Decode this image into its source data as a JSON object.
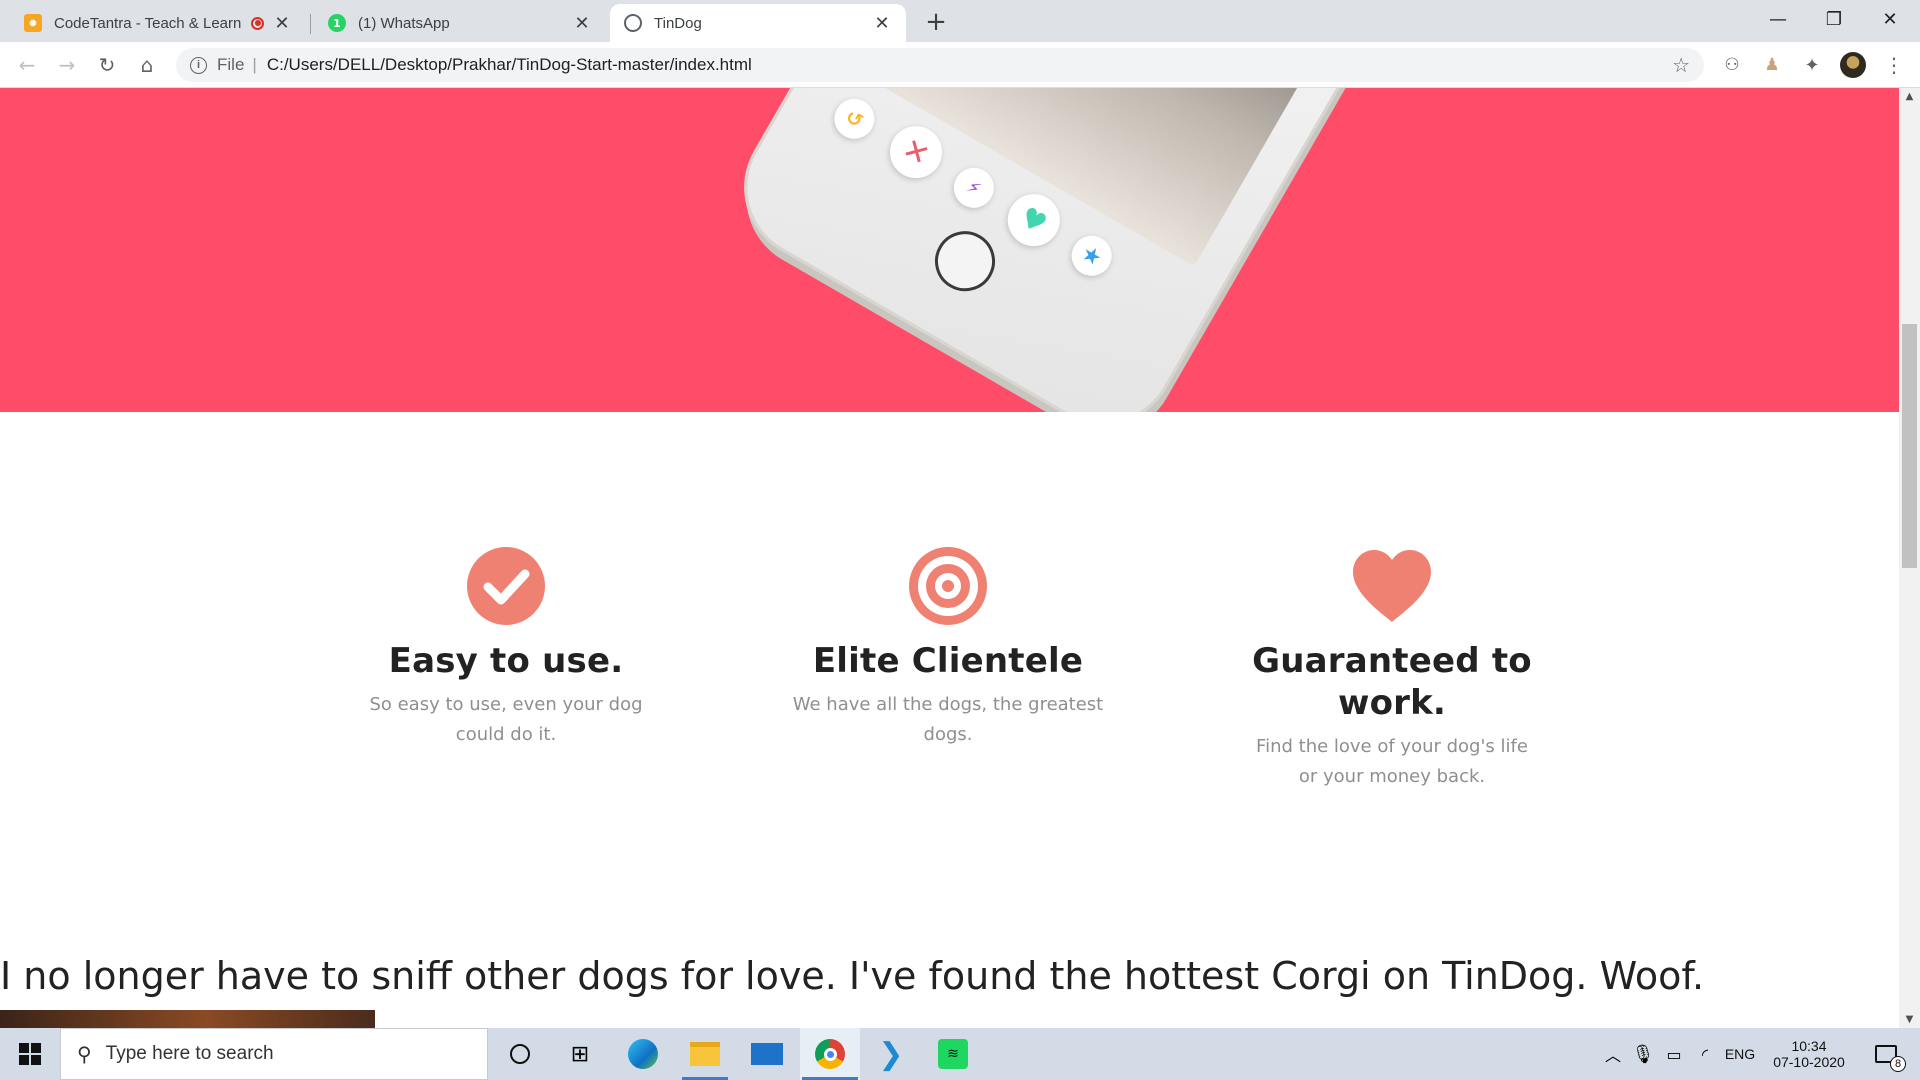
{
  "browser": {
    "tabs": [
      {
        "title": "CodeTantra - Teach & Learn",
        "favicon": "codetantra-icon"
      },
      {
        "title": "(1) WhatsApp",
        "favicon": "whatsapp-icon",
        "badge": "1"
      },
      {
        "title": "TinDog",
        "favicon": "globe-icon"
      }
    ],
    "address": {
      "scheme": "File",
      "path": "C:/Users/DELL/Desktop/Prakhar/TinDog-Start-master/index.html"
    }
  },
  "page": {
    "hero_color": "#ff4c68",
    "features": [
      {
        "icon": "check-circle-icon",
        "title": "Easy to use.",
        "text": "So easy to use, even your dog could do it."
      },
      {
        "icon": "bullseye-icon",
        "title": "Elite Clientele",
        "text": "We have all the dogs, the greatest dogs."
      },
      {
        "icon": "heart-icon",
        "title": "Guaranteed to work.",
        "text": "Find the love of your dog's life or your money back."
      }
    ],
    "feature_icon_color": "#ef8172",
    "testimonial": "I no longer have to sniff other dogs for love. I've found the hottest Corgi on TinDog. Woof."
  },
  "taskbar": {
    "search_placeholder": "Type here to search",
    "language": "ENG",
    "time": "10:34",
    "date": "07-10-2020",
    "notification_count": "8"
  }
}
